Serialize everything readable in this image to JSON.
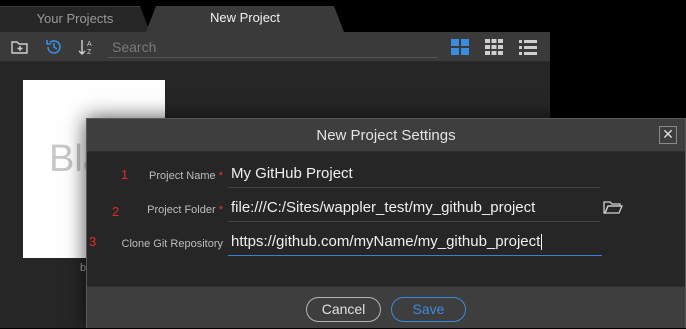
{
  "tabs": [
    {
      "label": "Your Projects",
      "active": false
    },
    {
      "label": "New Project",
      "active": true
    }
  ],
  "toolbar": {
    "search_placeholder": "Search",
    "icons": [
      "add-folder-icon",
      "history-icon",
      "sort-az-icon",
      "grid-large-icon",
      "grid-small-icon",
      "list-icon"
    ],
    "active_view": "grid-large"
  },
  "background_card": {
    "text": "Bla",
    "caption": "b"
  },
  "dialog": {
    "title": "New Project Settings",
    "close_label": "✕",
    "rows": [
      {
        "number": "1",
        "label": "Project Name",
        "required": "*",
        "value": "My GitHub Project"
      },
      {
        "number": "2",
        "label": "Project Folder",
        "required": "*",
        "value": "file:///C:/Sites/wappler_test/my_github_project"
      },
      {
        "number": "3",
        "label": "Clone Git Repository",
        "required": "",
        "value": "https://github.com/myName/my_github_project"
      }
    ],
    "cancel_label": "Cancel",
    "save_label": "Save"
  },
  "colors": {
    "accent": "#3b8be0",
    "annotation": "#e02a2a",
    "dialog_bg": "#3e3e3e",
    "body_bg": "#262626"
  }
}
